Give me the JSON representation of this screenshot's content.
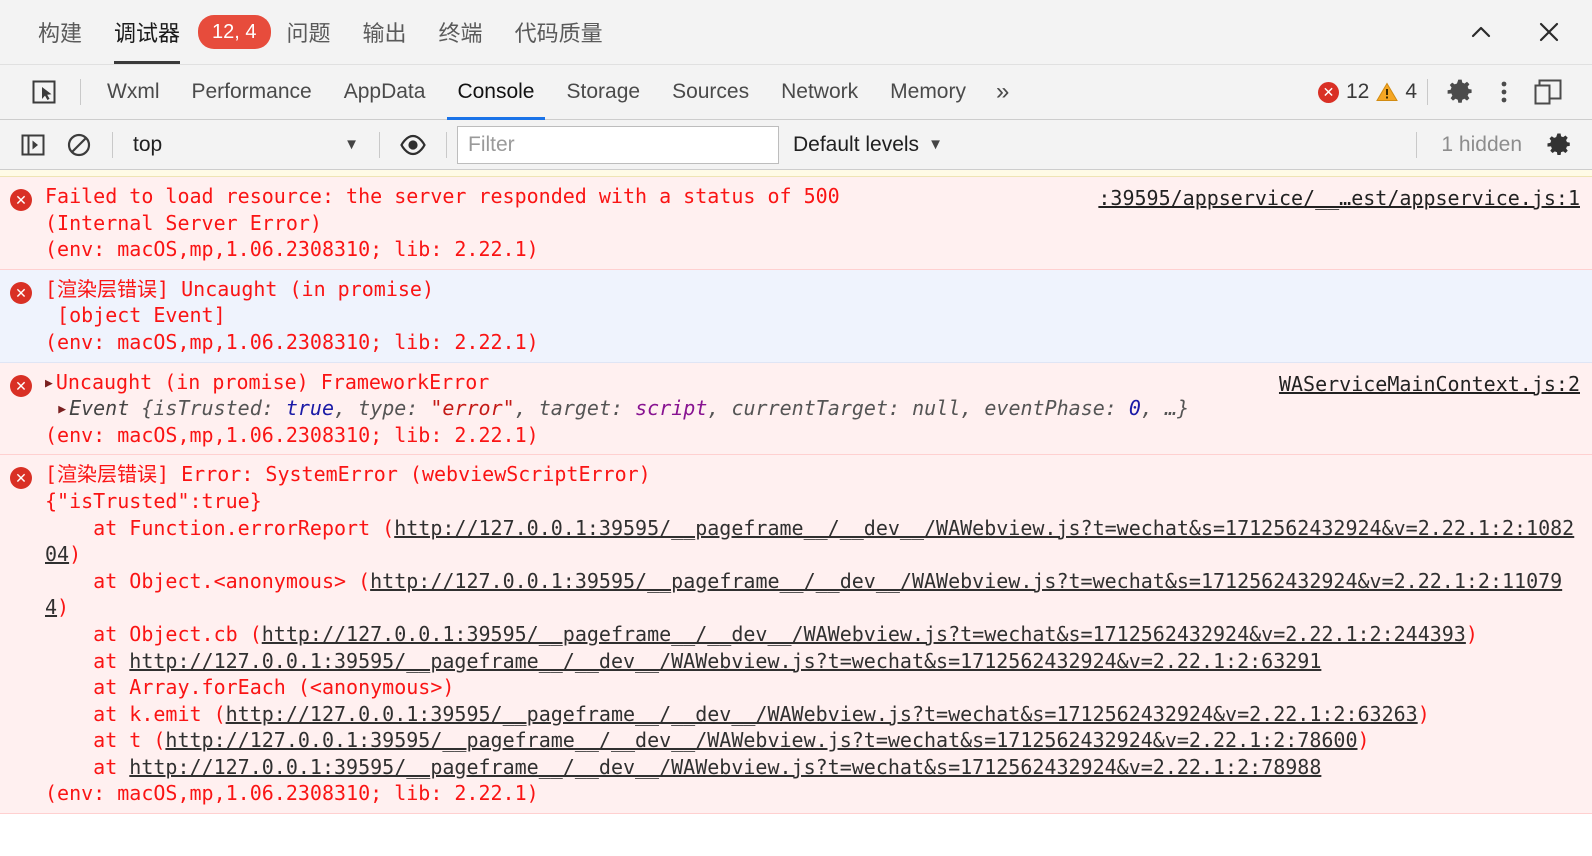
{
  "ide": {
    "tabs": [
      {
        "label": "构建",
        "active": false
      },
      {
        "label": "调试器",
        "active": true
      },
      {
        "label": "问题",
        "active": false
      },
      {
        "label": "输出",
        "active": false
      },
      {
        "label": "终端",
        "active": false
      },
      {
        "label": "代码质量",
        "active": false
      }
    ],
    "error_pill": "12, 4",
    "collapse_label": "收起",
    "close_label": "关闭",
    "accent": "#e74c3c"
  },
  "devtools": {
    "inspect_icon": "inspect-element-icon",
    "tabs": [
      {
        "label": "Wxml",
        "active": false
      },
      {
        "label": "Performance",
        "active": false
      },
      {
        "label": "AppData",
        "active": false
      },
      {
        "label": "Console",
        "active": true
      },
      {
        "label": "Storage",
        "active": false
      },
      {
        "label": "Sources",
        "active": false
      },
      {
        "label": "Network",
        "active": false
      },
      {
        "label": "Memory",
        "active": false
      }
    ],
    "more_tabs": "»",
    "error_count": "12",
    "warning_count": "4",
    "error_glyph": "✕",
    "active_tab_color": "#1a73e8",
    "error_color": "#d93025",
    "warning_color": "#f5a623"
  },
  "console_toolbar": {
    "sidebar_toggle_icon": "show-console-sidebar-icon",
    "clear_icon": "clear-console-icon",
    "context": "top",
    "context_caret": "▼",
    "eye_icon": "live-expression-icon",
    "filter_placeholder": "Filter",
    "filter_value": "",
    "levels": "Default levels",
    "levels_caret": "▼",
    "hidden_label": "1 hidden",
    "settings_icon": "console-settings-gear-icon"
  },
  "console_messages": [
    {
      "id": "msg-failed-load-500",
      "level": "error",
      "bg": "#fff0f0",
      "lines": [
        "Failed to load resource: the server responded with a status of 500",
        "(Internal Server Error)",
        "(env: macOS,mp,1.06.2308310; lib: 2.22.1)"
      ],
      "source_link": ":39595/appservice/__…est/appservice.js:1"
    },
    {
      "id": "msg-render-uncaught-event",
      "level": "error",
      "bg": "#eff3fd",
      "lines": [
        "[渲染层错误] Uncaught (in promise)",
        " [object Event]",
        "(env: macOS,mp,1.06.2308310; lib: 2.22.1)"
      ],
      "source_link": ""
    },
    {
      "id": "msg-framework-error",
      "level": "error",
      "bg": "#fff0f0",
      "title": "Uncaught (in promise) FrameworkError",
      "object_preview": {
        "name": "Event",
        "props": [
          {
            "key": "isTrusted",
            "value": "true",
            "kind": "bool"
          },
          {
            "key": "type",
            "value": "\"error\"",
            "kind": "string"
          },
          {
            "key": "target",
            "value": "script",
            "kind": "node"
          },
          {
            "key": "currentTarget",
            "value": "null",
            "kind": "plain"
          },
          {
            "key": "eventPhase",
            "value": "0",
            "kind": "number"
          }
        ],
        "ellipsis": "…"
      },
      "env_line": "(env: macOS,mp,1.06.2308310; lib: 2.22.1)",
      "source_link": "WAServiceMainContext.js:2"
    },
    {
      "id": "msg-systemerror-webviewscripterror",
      "level": "error",
      "bg": "#fff0f0",
      "header": "[渲染层错误] Error: SystemError (webviewScriptError)",
      "payload": "{\"isTrusted\":true}",
      "stack": [
        {
          "fn": "    at Function.errorReport (",
          "url": "http://127.0.0.1:39595/__pageframe__/__dev__/WAWebview.js?t=wechat&s=1712562432924&v=2.22.1:2:108204",
          "tail": ")"
        },
        {
          "fn": "    at Object.<anonymous> (",
          "url": "http://127.0.0.1:39595/__pageframe__/__dev__/WAWebview.js?t=wechat&s=1712562432924&v=2.22.1:2:110794",
          "tail": ")"
        },
        {
          "fn": "    at Object.cb (",
          "url": "http://127.0.0.1:39595/__pageframe__/__dev__/WAWebview.js?t=wechat&s=1712562432924&v=2.22.1:2:244393",
          "tail": ")"
        },
        {
          "fn": "    at ",
          "url": "http://127.0.0.1:39595/__pageframe__/__dev__/WAWebview.js?t=wechat&s=1712562432924&v=2.22.1:2:63291",
          "tail": ""
        },
        {
          "fn": "    at Array.forEach (<anonymous>)",
          "url": "",
          "tail": ""
        },
        {
          "fn": "    at k.emit (",
          "url": "http://127.0.0.1:39595/__pageframe__/__dev__/WAWebview.js?t=wechat&s=1712562432924&v=2.22.1:2:63263",
          "tail": ")"
        },
        {
          "fn": "    at t (",
          "url": "http://127.0.0.1:39595/__pageframe__/__dev__/WAWebview.js?t=wechat&s=1712562432924&v=2.22.1:2:78600",
          "tail": ")"
        },
        {
          "fn": "    at ",
          "url": "http://127.0.0.1:39595/__pageframe__/__dev__/WAWebview.js?t=wechat&s=1712562432924&v=2.22.1:2:78988",
          "tail": ""
        }
      ],
      "env_line": "(env: macOS,mp,1.06.2308310; lib: 2.22.1)",
      "source_link": ""
    }
  ]
}
